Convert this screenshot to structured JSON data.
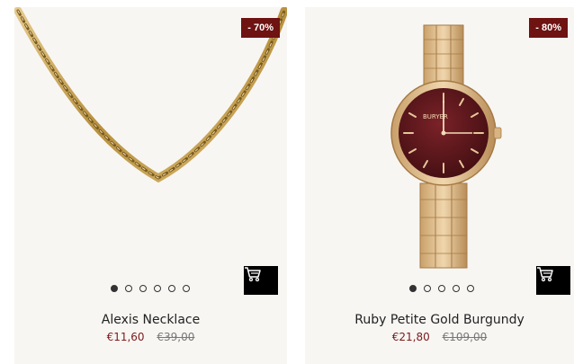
{
  "products": [
    {
      "name": "Alexis Necklace",
      "discount_badge": "- 70%",
      "price_current": "€11,60",
      "price_original": "€39,00",
      "image_icon": "gold-chain-necklace-image",
      "carousel_dots": 6,
      "carousel_active_index": 0
    },
    {
      "name": "Ruby Petite Gold Burgundy",
      "discount_badge": "- 80%",
      "price_current": "€21,80",
      "price_original": "€109,00",
      "image_icon": "gold-watch-burgundy-dial-image",
      "watch_brand": "BURYER",
      "carousel_dots": 5,
      "carousel_active_index": 0
    }
  ],
  "cart_icon": "shopping-cart-icon",
  "colors": {
    "badge_bg": "#6e1212",
    "price_current": "#7a1a1a",
    "card_bg": "#f8f6f3",
    "cart_button_bg": "#000000",
    "gold": "#c9a65a",
    "dial": "#5a1518"
  }
}
